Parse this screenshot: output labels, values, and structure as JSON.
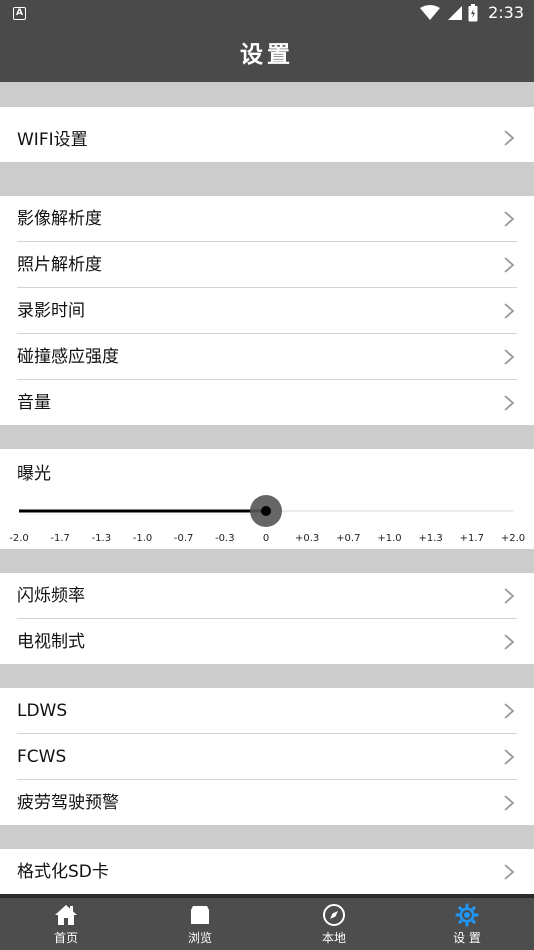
{
  "status_bar": {
    "time": "2:33",
    "notification_badge": "A"
  },
  "header": {
    "title": "设置"
  },
  "groups": [
    {
      "items": [
        {
          "label": "WIFI设置"
        }
      ]
    },
    {
      "items": [
        {
          "label": "影像解析度"
        },
        {
          "label": "照片解析度"
        },
        {
          "label": "录影时间"
        },
        {
          "label": "碰撞感应强度"
        },
        {
          "label": "音量"
        }
      ]
    },
    {
      "items": [
        {
          "label": "闪烁频率"
        },
        {
          "label": "电视制式"
        }
      ]
    },
    {
      "items": [
        {
          "label": "LDWS"
        },
        {
          "label": "FCWS"
        },
        {
          "label": "疲劳驾驶预警"
        }
      ]
    },
    {
      "items": [
        {
          "label": "格式化SD卡"
        }
      ]
    }
  ],
  "exposure": {
    "title": "曝光",
    "ticks": [
      "-2.0",
      "-1.7",
      "-1.3",
      "-1.0",
      "-0.7",
      "-0.3",
      "0",
      "+0.3",
      "+0.7",
      "+1.0",
      "+1.3",
      "+1.7",
      "+2.0"
    ],
    "selected_index": 6,
    "selected_value": "0"
  },
  "bottom_nav": [
    {
      "label": "首页",
      "icon": "home-icon",
      "active": false
    },
    {
      "label": "浏览",
      "icon": "browse-icon",
      "active": false
    },
    {
      "label": "本地",
      "icon": "compass-icon",
      "active": false
    },
    {
      "label": "设 置",
      "icon": "gear-icon",
      "active": true
    }
  ],
  "colors": {
    "bar_bg": "#4a4a4a",
    "separator_bg": "#cccccc",
    "accent_active": "#2196f3",
    "slider_track": "#000000",
    "slider_thumb": "#555555"
  }
}
